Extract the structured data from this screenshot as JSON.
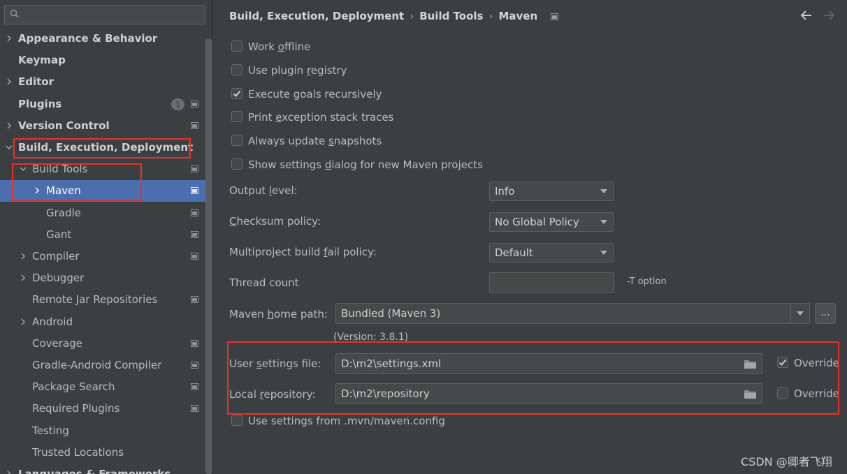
{
  "sidebar": {
    "search": {
      "placeholder": "",
      "value": ""
    },
    "items": [
      {
        "label": "Appearance & Behavior",
        "bold": true,
        "chevron": "right",
        "level": 0
      },
      {
        "label": "Keymap",
        "bold": true,
        "chevron": "none",
        "level": 0
      },
      {
        "label": "Editor",
        "bold": true,
        "chevron": "right",
        "level": 0
      },
      {
        "label": "Plugins",
        "bold": true,
        "chevron": "none",
        "level": 0,
        "badge": "1",
        "proj": true
      },
      {
        "label": "Version Control",
        "bold": true,
        "chevron": "right",
        "level": 0,
        "proj": true
      },
      {
        "label": "Build, Execution, Deployment",
        "bold": true,
        "chevron": "down",
        "level": 0
      },
      {
        "label": "Build Tools",
        "bold": false,
        "chevron": "down",
        "level": 1,
        "proj": true
      },
      {
        "label": "Maven",
        "bold": false,
        "chevron": "right",
        "level": 2,
        "proj": true,
        "selected": true
      },
      {
        "label": "Gradle",
        "bold": false,
        "chevron": "none",
        "level": 2,
        "proj": true
      },
      {
        "label": "Gant",
        "bold": false,
        "chevron": "none",
        "level": 2,
        "proj": true
      },
      {
        "label": "Compiler",
        "bold": false,
        "chevron": "right",
        "level": 1,
        "proj": true
      },
      {
        "label": "Debugger",
        "bold": false,
        "chevron": "right",
        "level": 1
      },
      {
        "label": "Remote Jar Repositories",
        "bold": false,
        "chevron": "none",
        "level": 1,
        "proj": true
      },
      {
        "label": "Android",
        "bold": false,
        "chevron": "right",
        "level": 1
      },
      {
        "label": "Coverage",
        "bold": false,
        "chevron": "none",
        "level": 1,
        "proj": true
      },
      {
        "label": "Gradle-Android Compiler",
        "bold": false,
        "chevron": "none",
        "level": 1,
        "proj": true
      },
      {
        "label": "Package Search",
        "bold": false,
        "chevron": "none",
        "level": 1,
        "proj": true
      },
      {
        "label": "Required Plugins",
        "bold": false,
        "chevron": "none",
        "level": 1,
        "proj": true
      },
      {
        "label": "Testing",
        "bold": false,
        "chevron": "none",
        "level": 1
      },
      {
        "label": "Trusted Locations",
        "bold": false,
        "chevron": "none",
        "level": 1
      },
      {
        "label": "Languages & Frameworks",
        "bold": true,
        "chevron": "right",
        "level": 0
      }
    ]
  },
  "breadcrumb": {
    "items": [
      "Build, Execution, Deployment",
      "Build Tools",
      "Maven"
    ],
    "separator": "›"
  },
  "options": {
    "work_offline": {
      "pre": "Work ",
      "u": "o",
      "post": "ffline",
      "checked": false
    },
    "plugin_registry": {
      "pre": "Use plugin ",
      "u": "r",
      "post": "egistry",
      "checked": false
    },
    "goals_recursively": {
      "pre": "Execute ",
      "u": "g",
      "post": "oals recursively",
      "checked": true
    },
    "exception_traces": {
      "pre": "Print ",
      "u": "e",
      "post": "xception stack traces",
      "checked": false
    },
    "update_snapshots": {
      "pre": "Always update ",
      "u": "s",
      "post": "napshots",
      "checked": false
    },
    "settings_dialog": {
      "pre": "Show settings ",
      "u": "d",
      "post": "ialog for new Maven projects",
      "checked": false
    }
  },
  "fields": {
    "output_level": {
      "pre": "Output ",
      "u": "l",
      "post": "evel:",
      "value": "Info"
    },
    "checksum_policy": {
      "pre": "",
      "u": "C",
      "post": "hecksum policy:",
      "value": "No Global Policy"
    },
    "fail_policy": {
      "pre": "Multiproject build ",
      "u": "f",
      "post": "ail policy:",
      "value": "Default"
    },
    "thread_count": {
      "label": "Thread count",
      "value": "",
      "hint": "-T option"
    },
    "maven_home": {
      "pre": "Maven ",
      "u": "h",
      "post": "ome path:",
      "value": "Bundled (Maven 3)",
      "browse": "...",
      "version": "(Version: 3.8.1)"
    },
    "user_settings": {
      "pre": "User ",
      "u": "s",
      "post": "ettings file:",
      "value": "D:\\m2\\settings.xml",
      "override_label": "Override",
      "override_checked": true
    },
    "local_repository": {
      "pre": "Local ",
      "u": "r",
      "post": "epository:",
      "value": "D:\\m2\\repository",
      "override_label": "Override",
      "override_checked": false
    },
    "mvn_config": {
      "label": "Use settings from .mvn/maven.config",
      "checked": false
    }
  },
  "watermark": "CSDN @卿者飞翔",
  "colors": {
    "background": "#3c3f41",
    "selection": "#4b6eaf",
    "annotation_red": "#e5322d"
  }
}
